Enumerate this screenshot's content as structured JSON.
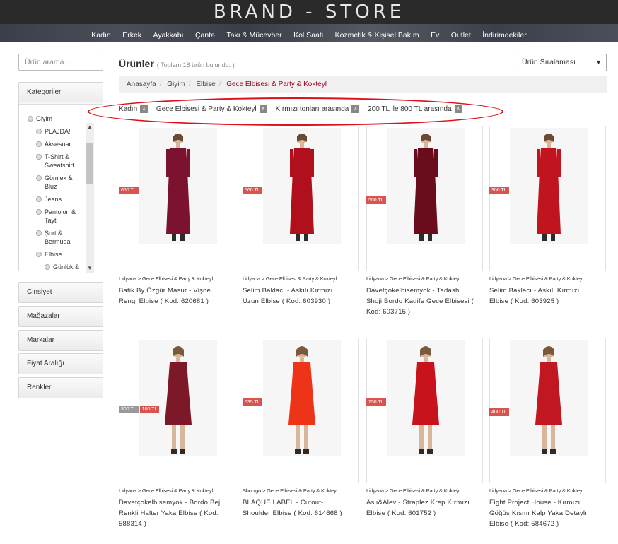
{
  "header": {
    "brand": "BRAND - STORE",
    "nav": [
      "Kadın",
      "Erkek",
      "Ayakkabı",
      "Çanta",
      "Takı & Mücevher",
      "Kol Saati",
      "Kozmetik & Kişisel Bakım",
      "Ev",
      "Outlet",
      "İndirimdekiler"
    ]
  },
  "search": {
    "placeholder": "Ürün arama..."
  },
  "sidebar": {
    "categories_label": "Kategoriler",
    "categories": [
      "Giyim",
      "PLAJDA!",
      "Aksesuar",
      "T-Shirt & Sweatshirt",
      "Gömlek & Bluz",
      "Jeans",
      "Pantolon & Tayt",
      "Şort & Bermuda",
      "Elbise",
      "Günlük &"
    ],
    "sections": [
      "Cinsiyet",
      "Mağazalar",
      "Markalar",
      "Fiyat Aralığı",
      "Renkler"
    ]
  },
  "main": {
    "title": "Ürünler",
    "count": "( Toplam 18 ürün bulundu. )",
    "sort_label": "Ürün Sıralaması",
    "breadcrumb": [
      "Anasayfa",
      "Giyim",
      "Elbise",
      "Gece Elbisesi & Party & Kokteyl"
    ],
    "filters": [
      "Kadın",
      "Gece Elbisesi & Party & Kokteyl",
      "Kırmızı tonları arasında",
      "200 TL ile 800 TL arasında"
    ],
    "filter_remove": "x"
  },
  "products": [
    {
      "store": "Lidyana > Gece Elbisesi & Party & Kokteyl",
      "name": "Batik By Özgür Masur - Vişne Rengi Elbise ( Kod: 620681 )",
      "prices": [
        "650 TL"
      ],
      "color": "#7a1230"
    },
    {
      "store": "Lidyana > Gece Elbisesi & Party & Kokteyl",
      "name": "Selim Baklacı - Askılı Kırmızı Uzun Elbise ( Kod: 603930 )",
      "prices": [
        "560 TL"
      ],
      "color": "#b0101c"
    },
    {
      "store": "Lidyana > Gece Elbisesi & Party & Kokteyl",
      "name": "Davetçokelbisemyok - Tadashi Shoji Bordo Kadife Gece Elbisesi ( Kod: 603715 )",
      "prices": [
        "500 TL"
      ],
      "color": "#6b0c1c"
    },
    {
      "store": "Lidyana > Gece Elbisesi & Party & Kokteyl",
      "name": "Selim Baklacı - Askılı Kırmızı Elbise ( Kod: 603925 )",
      "prices": [
        "300 TL"
      ],
      "color": "#c0151f"
    },
    {
      "store": "Lidyana > Gece Elbisesi & Party & Kokteyl",
      "name": "Davetçokelbisemyok - Bordo Bej Renkli Halter Yaka Elbise ( Kod: 588314 )",
      "prices": [
        "300 TL",
        "100 TL"
      ],
      "color": "#7d1828"
    },
    {
      "store": "Shopigo > Gece Elbisesi & Party & Kokteyl",
      "name": "BLAQUE LABEL - Cutout-Shoulder Elbise ( Kod: 614668 )",
      "prices": [
        "535 TL"
      ],
      "color": "#ee3418"
    },
    {
      "store": "Lidyana > Gece Elbisesi & Party & Kokteyl",
      "name": "Aslı&Alev - Straplez Krep Kırmızı Elbise ( Kod: 601752 )",
      "prices": [
        "750 TL"
      ],
      "color": "#c8131c"
    },
    {
      "store": "Lidyana > Gece Elbisesi & Party & Kokteyl",
      "name": "Eight Project House - Kırmızı Göğüs Kısmı Kalp Yaka Detaylı Elbise ( Kod: 584672 )",
      "prices": [
        "400 TL"
      ],
      "color": "#c01722"
    }
  ]
}
